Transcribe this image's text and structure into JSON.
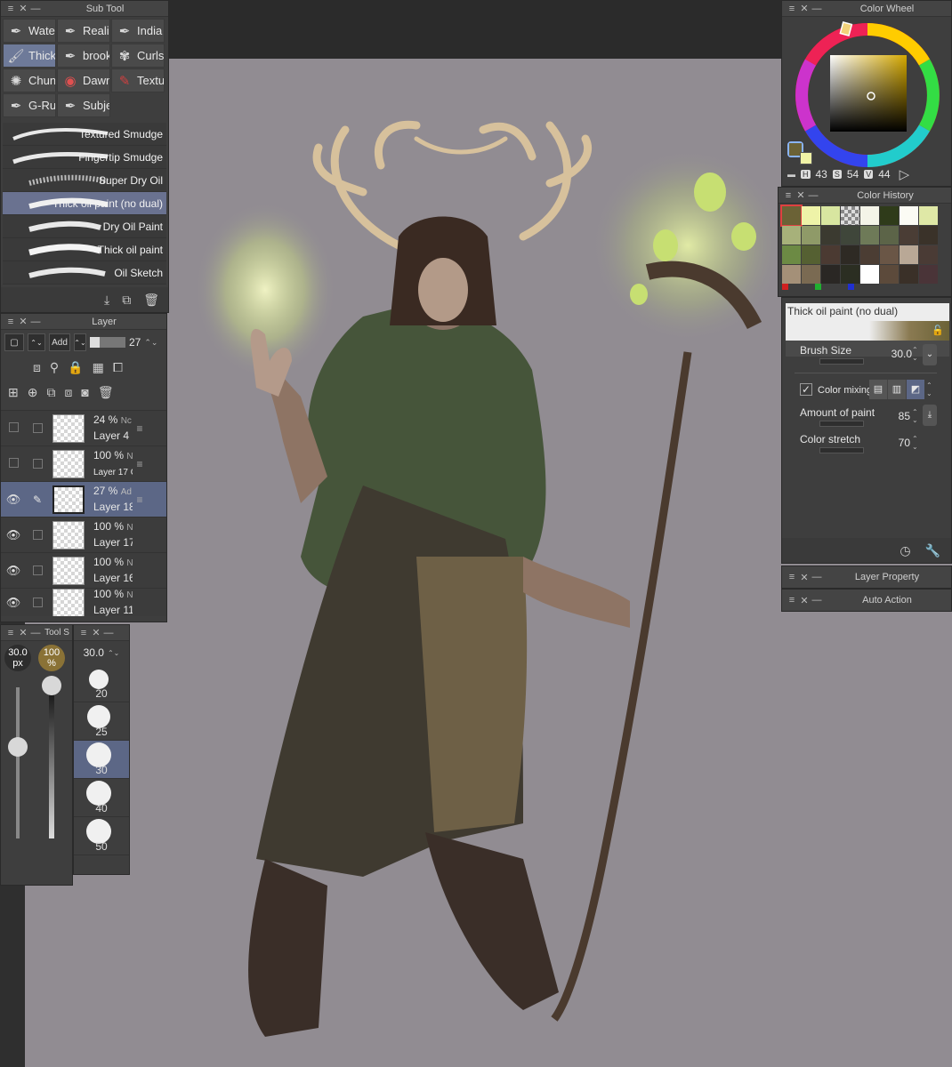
{
  "subtool": {
    "title": "Sub Tool",
    "tools": [
      {
        "label": "Water",
        "icon": "pen-icon"
      },
      {
        "label": "Realis",
        "icon": "pen-icon"
      },
      {
        "label": "India",
        "icon": "pen-icon"
      },
      {
        "label": "Thick",
        "icon": "brush-icon"
      },
      {
        "label": "brook",
        "icon": "pen-icon"
      },
      {
        "label": "Curls",
        "icon": "curls-icon"
      },
      {
        "label": "Chunl",
        "icon": "splat-icon"
      },
      {
        "label": "Dawn",
        "icon": "globe-icon"
      },
      {
        "label": "Textu",
        "icon": "texture-brush-icon"
      },
      {
        "label": "G-Ru",
        "icon": "pen-icon"
      },
      {
        "label": "Subje",
        "icon": "pen-icon"
      }
    ],
    "brushes": [
      "Textured Smudge",
      "Fingertip Smudge",
      "Super Dry Oil",
      "Thick oil paint (no dual)",
      "Dry Oil Paint",
      "Thick oil paint",
      "Oil Sketch"
    ],
    "selected_brush": "Thick oil paint (no dual)"
  },
  "layer": {
    "title": "Layer",
    "blend_mode": "Add",
    "opacity": "27",
    "rows": [
      {
        "opacity": "24 %",
        "mode": "Nc",
        "name": "Layer 4",
        "visible": false
      },
      {
        "opacity": "100 %",
        "mode": "N",
        "name": "Layer 17 C",
        "visible": false
      },
      {
        "opacity": "27 %",
        "mode": "Ad",
        "name": "Layer 18",
        "visible": true
      },
      {
        "opacity": "100 %",
        "mode": "N",
        "name": "Layer 17",
        "visible": true
      },
      {
        "opacity": "100 %",
        "mode": "N",
        "name": "Layer 16",
        "visible": true
      },
      {
        "opacity": "100 %",
        "mode": "N",
        "name": "Layer 11",
        "visible": true
      }
    ]
  },
  "toolsize": {
    "title": "Tool S",
    "size_value": "30.0",
    "size_unit": "px",
    "opacity_value": "100",
    "opacity_unit": "%"
  },
  "brushsize": {
    "value": "30.0",
    "items": [
      "20",
      "25",
      "30",
      "40",
      "50"
    ],
    "selected": "30"
  },
  "colorwheel": {
    "title": "Color Wheel",
    "h": "43",
    "s": "54",
    "v": "44",
    "h_key": "H",
    "s_key": "S",
    "v_key": "V",
    "main_color": "#6b6236",
    "sub_color": "#f0f3a6"
  },
  "colorhistory": {
    "title": "Color History",
    "swatches": [
      "#6b6236",
      "#eef3a8",
      "#d8e6a0",
      "checker",
      "#f4f4e8",
      "#2f3b1a",
      "#fbfbf4",
      "#dfe8a6",
      "#a7b17a",
      "#8f9a68",
      "#3b3a30",
      "#3f463a",
      "#6e7a58",
      "#5c6448",
      "#4a3d35",
      "#3a3229",
      "#6c8a44",
      "#556032",
      "#4b3a32",
      "#2e2a24",
      "#4b3d33",
      "#6a5646",
      "#b9a896",
      "#4a3b35",
      "#a49078",
      "#7a6a52",
      "#2a2724",
      "#2b2e22",
      "#ffffff",
      "#5c4a3b",
      "#3a3028",
      "#4a3438"
    ]
  },
  "toolprop": {
    "preview_label": "Thick oil paint (no dual)",
    "brush_size_label": "Brush Size",
    "brush_size_value": "30.0",
    "color_mixing_label": "Color mixing",
    "amount_label": "Amount of paint",
    "amount_value": "85",
    "stretch_label": "Color stretch",
    "stretch_value": "70"
  },
  "layerprop": {
    "title": "Layer Property"
  },
  "autoaction": {
    "title": "Auto Action"
  }
}
